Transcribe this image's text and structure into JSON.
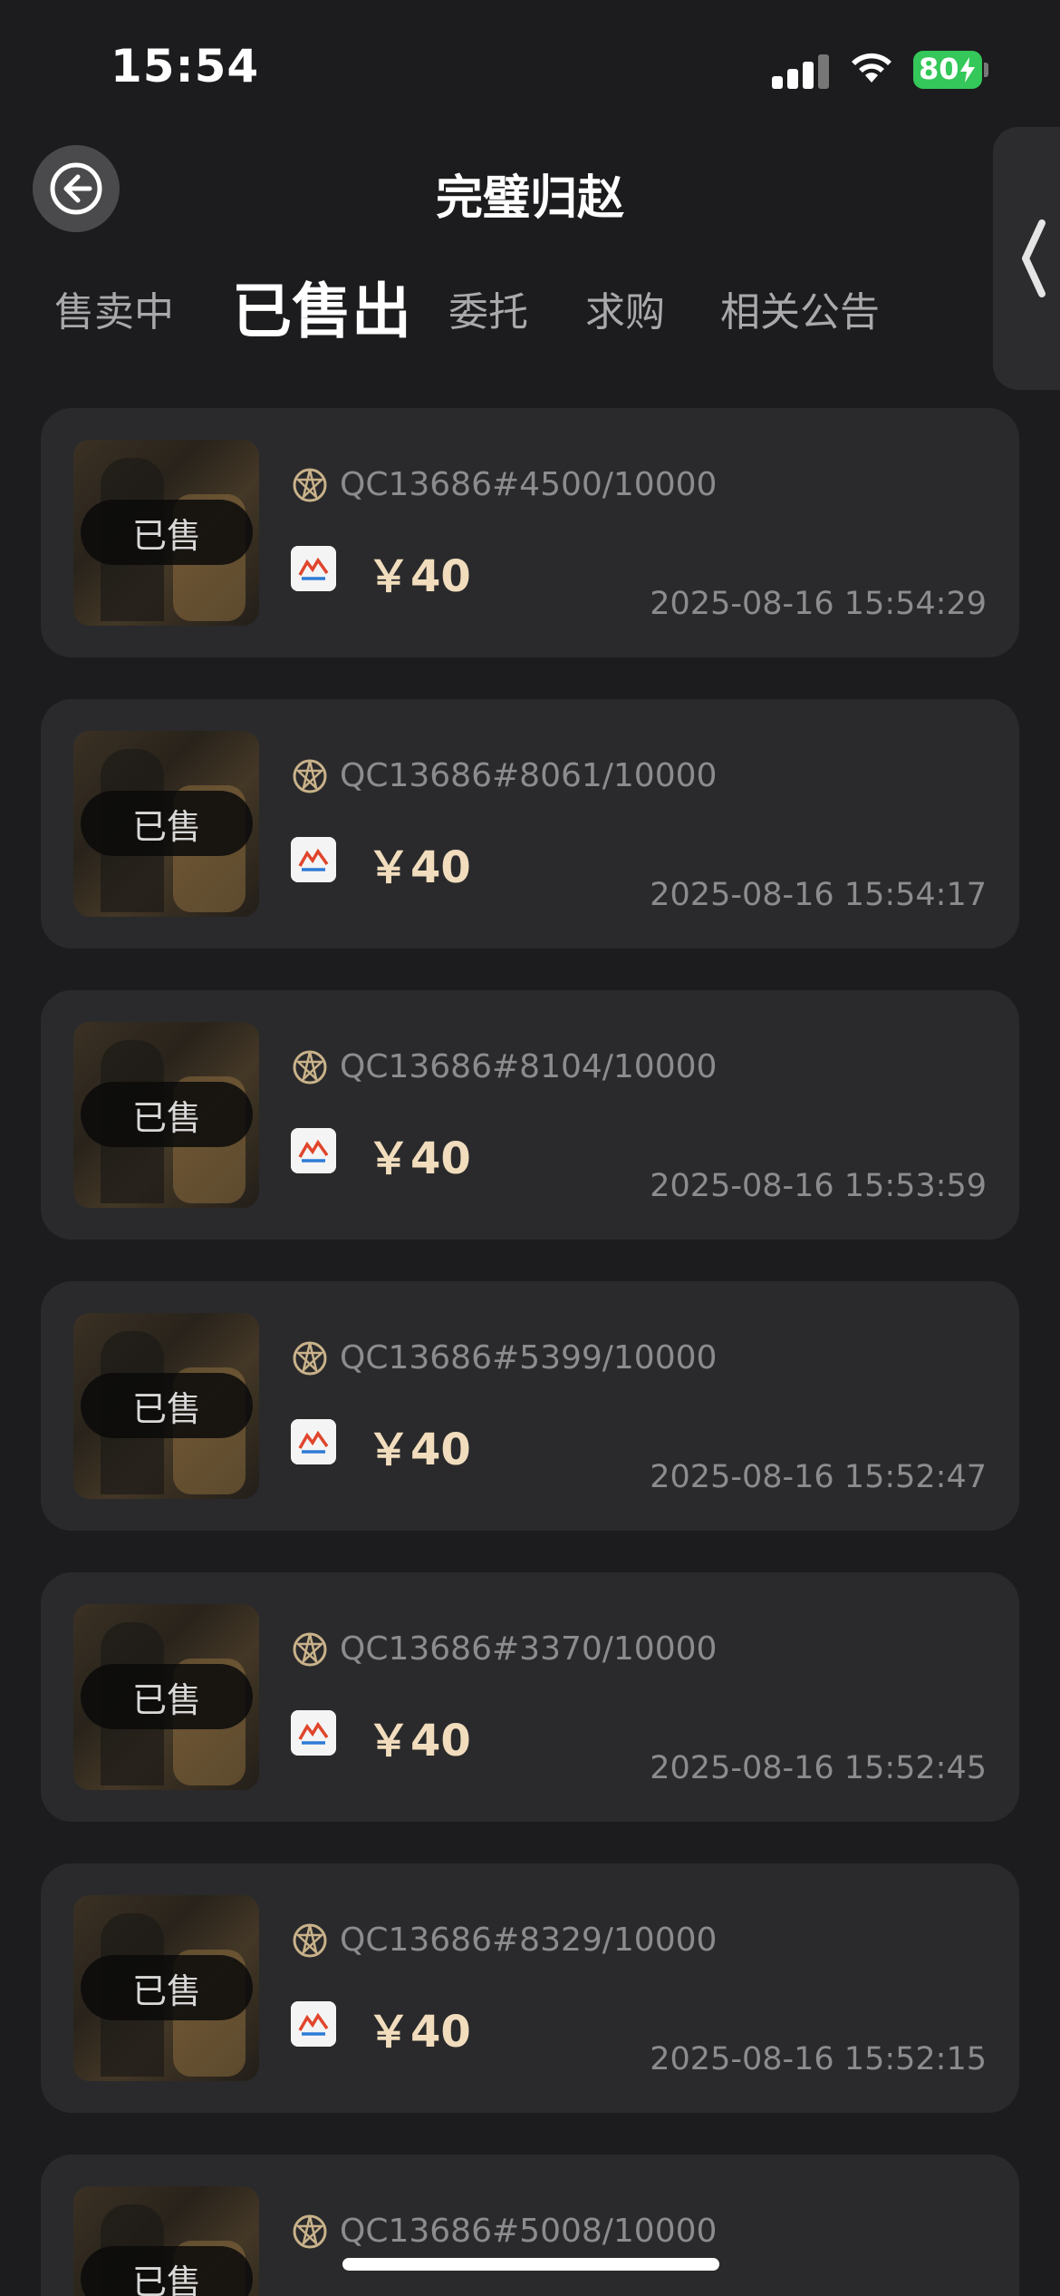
{
  "status_bar": {
    "time": "15:54",
    "battery": "80"
  },
  "header": {
    "title": "完璧归赵"
  },
  "tabs": [
    {
      "label": "售卖中",
      "active": false
    },
    {
      "label": "已售出",
      "active": true
    },
    {
      "label": "委托",
      "active": false
    },
    {
      "label": "求购",
      "active": false
    },
    {
      "label": "相关公告",
      "active": false
    }
  ],
  "items": [
    {
      "badge": "已售",
      "serial": "QC13686#4500/10000",
      "price": "￥40",
      "time": "2025-08-16 15:54:29"
    },
    {
      "badge": "已售",
      "serial": "QC13686#8061/10000",
      "price": "￥40",
      "time": "2025-08-16 15:54:17"
    },
    {
      "badge": "已售",
      "serial": "QC13686#8104/10000",
      "price": "￥40",
      "time": "2025-08-16 15:53:59"
    },
    {
      "badge": "已售",
      "serial": "QC13686#5399/10000",
      "price": "￥40",
      "time": "2025-08-16 15:52:47"
    },
    {
      "badge": "已售",
      "serial": "QC13686#3370/10000",
      "price": "￥40",
      "time": "2025-08-16 15:52:45"
    },
    {
      "badge": "已售",
      "serial": "QC13686#8329/10000",
      "price": "￥40",
      "time": "2025-08-16 15:52:15"
    },
    {
      "badge": "已售",
      "serial": "QC13686#5008/10000",
      "price": "",
      "time": ""
    }
  ],
  "colors": {
    "background": "#1c1c1e",
    "card": "#2a2a2c",
    "price": "#f1ddbd",
    "battery": "#34c759"
  },
  "icons": {
    "back": "back-arrow-circle-icon",
    "side": "chevron-left-icon",
    "chain": "chain-network-icon",
    "pay": "payment-logo-icon"
  }
}
